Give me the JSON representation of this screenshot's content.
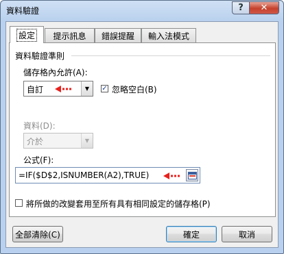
{
  "window": {
    "title": "資料驗證"
  },
  "titlebar": {
    "help_label": "?",
    "close_label": "✕"
  },
  "tabs": [
    {
      "label": "設定",
      "active": true
    },
    {
      "label": "提示訊息",
      "active": false
    },
    {
      "label": "錯誤提醒",
      "active": false
    },
    {
      "label": "輸入法模式",
      "active": false
    }
  ],
  "criteria": {
    "group_label": "資料驗證準則",
    "allow_label": "儲存格內允許(A):",
    "allow_value": "自訂",
    "ignore_blank_label": "忽略空白(B)",
    "ignore_blank_checked": "✓",
    "data_label": "資料(D):",
    "data_value": "介於",
    "formula_label": "公式(F):",
    "formula_value": "=IF($D$2,ISNUMBER(A2),TRUE)"
  },
  "apply_all": {
    "label": "將所做的改變套用至所有具有相同設定的儲存格(P)",
    "checked": ""
  },
  "buttons": {
    "clear_all": "全部清除(C)",
    "ok": "確定",
    "cancel": "取消"
  },
  "colors": {
    "annotation_arrow": "#e8201c",
    "title_gradient_top": "#cfe0f4",
    "close_button": "#c5412c"
  }
}
